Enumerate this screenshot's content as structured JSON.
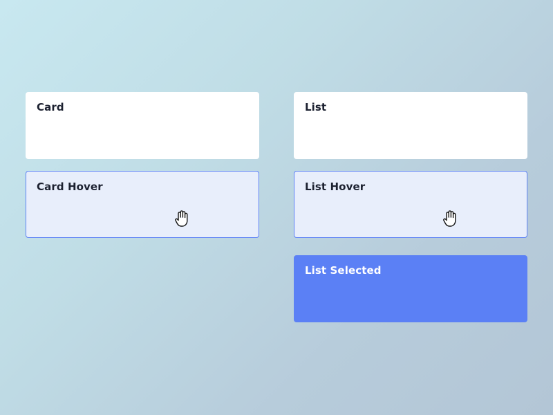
{
  "cards": {
    "card": {
      "label": "Card"
    },
    "list": {
      "label": "List"
    },
    "card_hover": {
      "label": "Card Hover"
    },
    "list_hover": {
      "label": "List Hover"
    },
    "list_selected": {
      "label": "List Selected"
    }
  },
  "colors": {
    "card_background": "#ffffff",
    "hover_background": "#e8eefb",
    "hover_border": "#5b80f5",
    "selected_background": "#5b80f5",
    "label_text": "#1c2130",
    "selected_text": "#ffffff"
  },
  "cursor": {
    "icon": "hand-pointer-icon"
  }
}
